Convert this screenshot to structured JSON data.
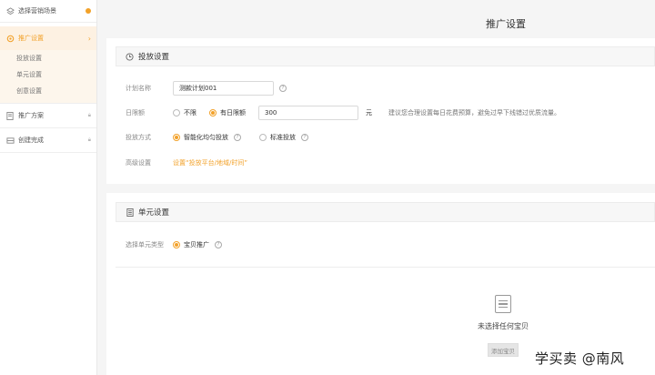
{
  "sidebar": {
    "steps": [
      {
        "label": "选择营销场景",
        "icon": "scene-icon"
      },
      {
        "label": "推广设置",
        "icon": "gear-icon"
      },
      {
        "label": "推广方案",
        "icon": "document-icon"
      },
      {
        "label": "创建完成",
        "icon": "flag-icon"
      }
    ],
    "sub_items": [
      "投放设置",
      "单元设置",
      "创意设置"
    ]
  },
  "page_title": "推广设置",
  "delivery": {
    "title": "投放设置",
    "plan_name": {
      "label": "计划名称",
      "value": "测款计划001"
    },
    "daily_budget": {
      "label": "日限额",
      "option_unlimited": "不限",
      "option_limited": "有日限额",
      "value": "300",
      "unit": "元",
      "hint": "建议您合理设置每日花费预算，避免过早下线错过优质流量。"
    },
    "delivery_method": {
      "label": "投放方式",
      "option_smart": "智能化均匀投放",
      "option_standard": "标准投放"
    },
    "advanced": {
      "label": "高级设置",
      "link": "设置“投放平台/地域/时间”"
    }
  },
  "unit": {
    "title": "单元设置",
    "type_label": "选择单元类型",
    "type_option": "宝贝推广",
    "empty_text": "未选择任何宝贝",
    "add_button": "添加宝贝"
  },
  "watermark": "学买卖 @南风",
  "colors": {
    "accent": "#f2a129"
  }
}
